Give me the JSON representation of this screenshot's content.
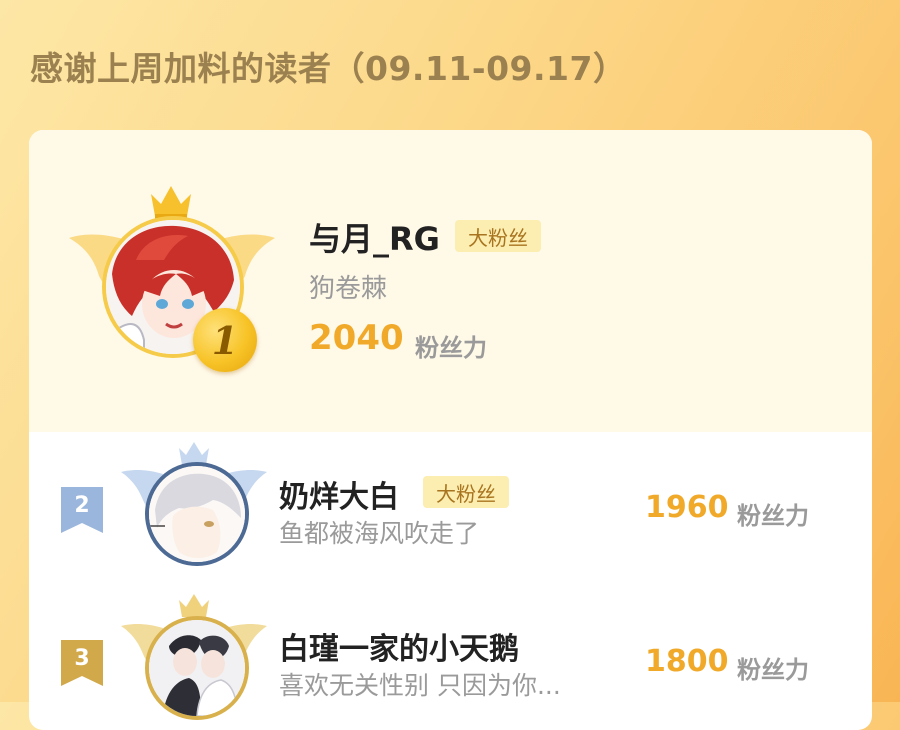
{
  "page": {
    "title": "感谢上周加料的读者（09.11-09.17）"
  },
  "colors": {
    "score": "#f1a92a",
    "badge_bg": "#fcedb0",
    "badge_text": "#a8741f",
    "rank2": "#9ab6dc",
    "rank3": "#d1a94a"
  },
  "leaderboard": [
    {
      "rank": "1",
      "name": "与月_RG",
      "badge": "大粉丝",
      "motto": "狗卷棘",
      "score": "2040",
      "unit": "粉丝力"
    },
    {
      "rank": "2",
      "name": "奶烊大白",
      "badge": "大粉丝",
      "motto": "鱼都被海风吹走了",
      "score": "1960",
      "unit": "粉丝力"
    },
    {
      "rank": "3",
      "name": "白瑾一家的小天鹅",
      "motto": "喜欢无关性别 只因为你...",
      "score": "1800",
      "unit": "粉丝力"
    }
  ]
}
